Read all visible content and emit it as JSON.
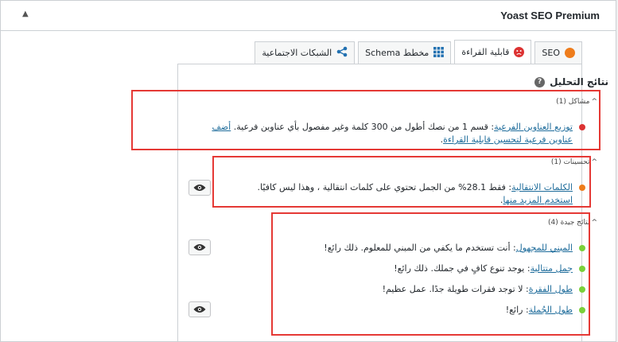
{
  "panel": {
    "title": "Yoast SEO Premium"
  },
  "tabs": [
    {
      "label": "SEO",
      "color": "#ee7c1b",
      "icon": "seo-score-dot"
    },
    {
      "label": "قابلية القراءة",
      "color": "#dc3232",
      "icon": "readability-sad-face"
    },
    {
      "label": "مخطط Schema",
      "icon": "grid-icon"
    },
    {
      "label": "الشبكات الاجتماعية",
      "icon": "share-icon"
    }
  ],
  "results": {
    "heading": "نتائج التحليل",
    "problems": {
      "title": "مشاكل (1)",
      "items": [
        {
          "link": "توزيع العناوين الفرعية",
          "text": ": قسم 1 من نصك أطول من 300 كلمة وغير مفصول بأي عناوين فرعية.",
          "link2": "أضف عناوين فرعية لتحسين قابلية القراءة",
          "text2": ".",
          "color": "#dc3232"
        }
      ]
    },
    "improvements": {
      "title": "تحسينات (1)",
      "items": [
        {
          "link": "الكلمات الانتقالية",
          "text": ": فقط 28.1% من الجمل تحتوي على كلمات انتقالية ، وهذا ليس كافيًا.",
          "link2": "استخدم المزيد منها",
          "text2": ".",
          "color": "#ee7c1b"
        }
      ]
    },
    "good": {
      "title": "نتائج جيدة (4)",
      "items": [
        {
          "link": "المبني للمجهول",
          "text": ": أنت تستخدم ما يكفي من المبني للمعلوم. ذلك رائع!",
          "color": "#7ad03a"
        },
        {
          "link": "جمل متتالية",
          "text": ": يوجد تنوع كافٍ في جملك. ذلك رائع!",
          "color": "#7ad03a"
        },
        {
          "link": "طول الفقرة",
          "text": ": لا توجد فقرات طويلة جدًا. عمل عظيم!",
          "color": "#7ad03a"
        },
        {
          "link": "طول الجُملة",
          "text": ": رائع!",
          "color": "#7ad03a"
        }
      ]
    }
  }
}
